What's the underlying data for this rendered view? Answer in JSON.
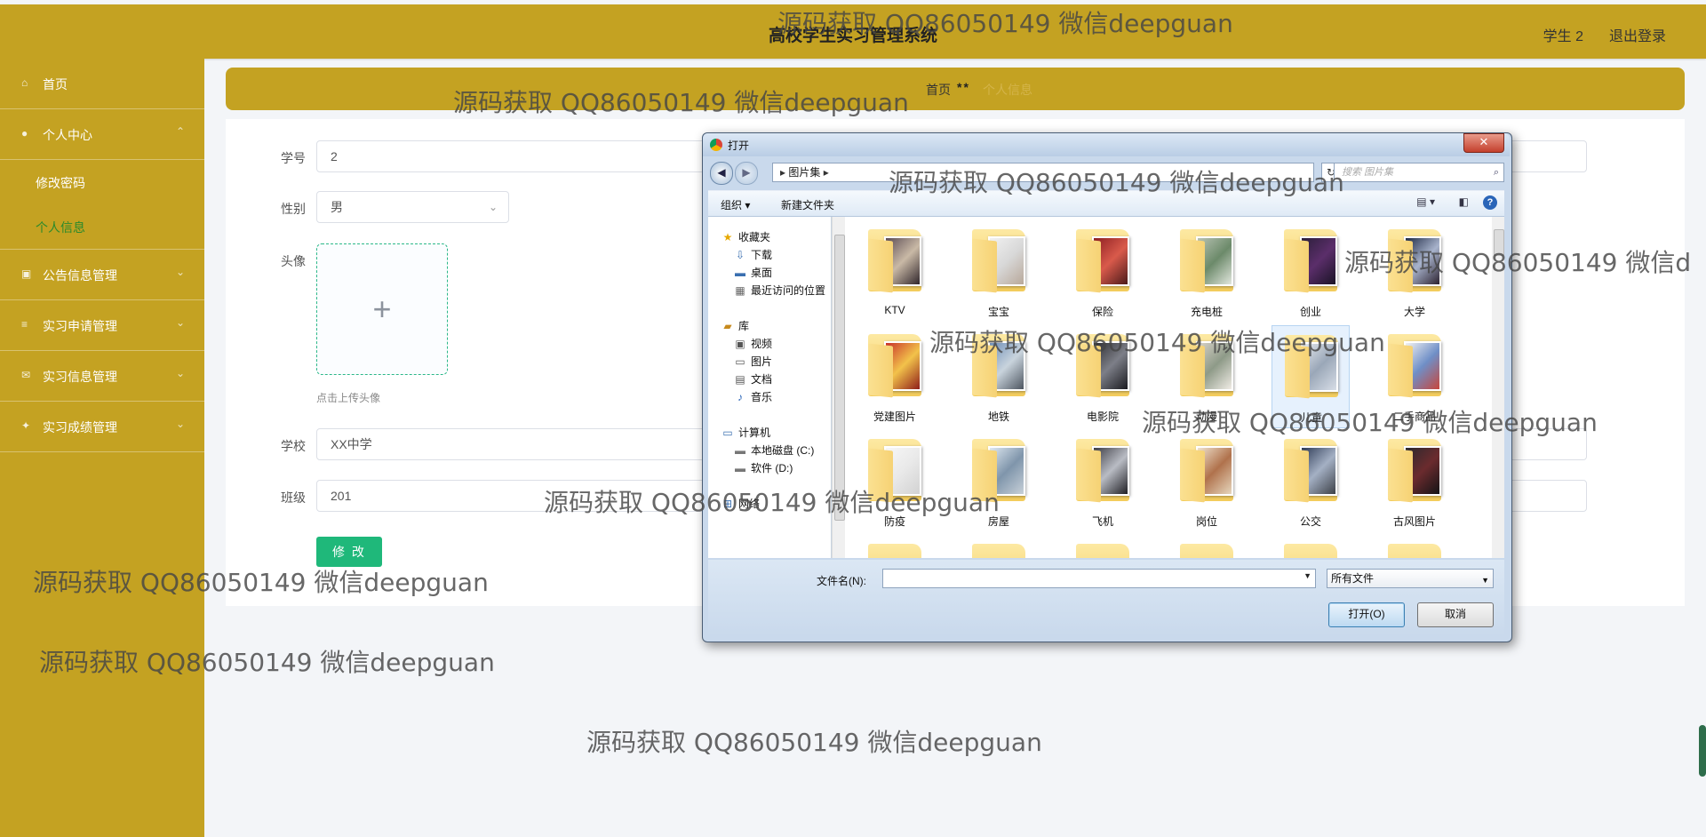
{
  "header": {
    "title": "高校学生实习管理系统",
    "user": "学生 2",
    "logout": "退出登录"
  },
  "sidebar": {
    "items": [
      {
        "label": "首页",
        "icon": "home-icon"
      },
      {
        "label": "个人中心",
        "icon": "user-icon"
      },
      {
        "label": "公告信息管理",
        "icon": "notice-icon"
      },
      {
        "label": "实习申请管理",
        "icon": "list-icon"
      },
      {
        "label": "实习信息管理",
        "icon": "mail-icon"
      },
      {
        "label": "实习成绩管理",
        "icon": "score-icon"
      }
    ],
    "sub_items": [
      {
        "label": "修改密码",
        "active": false
      },
      {
        "label": "个人信息",
        "active": true
      }
    ]
  },
  "breadcrumb": {
    "home": "首页",
    "separator": "**",
    "current": "个人信息"
  },
  "form": {
    "student_no_label": "学号",
    "student_no_value": "2",
    "gender_label": "性别",
    "gender_value": "男",
    "avatar_label": "头像",
    "avatar_plus": "+",
    "avatar_hint": "点击上传头像",
    "school_label": "学校",
    "school_value": "XX中学",
    "class_label": "班级",
    "class_value": "201",
    "submit_label": "修 改"
  },
  "dialog": {
    "title": "打开",
    "close": "✕",
    "address_crumbs": "图片集",
    "search_placeholder": "搜索 图片集",
    "toolbar": {
      "organize": "组织 ▾",
      "new_folder": "新建文件夹"
    },
    "nav": [
      {
        "label": "收藏夹",
        "icon": "star-icon"
      },
      {
        "label": "下载",
        "icon": "download-icon"
      },
      {
        "label": "桌面",
        "icon": "desktop-icon"
      },
      {
        "label": "最近访问的位置",
        "icon": "recent-icon"
      },
      {
        "label": "库",
        "icon": "library-icon"
      },
      {
        "label": "视频",
        "icon": "video-icon"
      },
      {
        "label": "图片",
        "icon": "picture-icon"
      },
      {
        "label": "文档",
        "icon": "document-icon"
      },
      {
        "label": "音乐",
        "icon": "music-icon"
      },
      {
        "label": "计算机",
        "icon": "computer-icon"
      },
      {
        "label": "本地磁盘 (C:)",
        "icon": "disk-icon"
      },
      {
        "label": "软件 (D:)",
        "icon": "disk-icon"
      },
      {
        "label": "网络",
        "icon": "network-icon"
      }
    ],
    "folders": [
      "KTV",
      "宝宝",
      "保险",
      "充电桩",
      "创业",
      "大学",
      "党建图片",
      "地铁",
      "电影院",
      "动漫",
      "儿童",
      "二手商品",
      "防疫",
      "房屋",
      "飞机",
      "岗位",
      "公交",
      "古风图片"
    ],
    "filename_label": "文件名(N):",
    "filename_value": "",
    "filetype": "所有文件",
    "open_button": "打开(O)",
    "cancel_button": "取消"
  },
  "watermarks": [
    "源码获取 QQ86050149 微信deepguan",
    "源码获取 QQ86050149 微信deepguan",
    "源码获取 QQ86050149 微信deepguan",
    "源码获取 QQ86050149 微信d",
    "源码获取 QQ86050149 微信deepguan",
    "源码获取 QQ86050149 微信deepguan",
    "源码获取 QQ86050149 微信deepguan",
    "源码获取 QQ86050149 微信deepguan",
    "源码获取 QQ86050149 微信deepguan",
    "源码获取 QQ86050149 微信deepguan"
  ],
  "colors": {
    "theme": "#c4a222",
    "accent": "#1fb87a",
    "active_sub": "#2b8a2b"
  }
}
